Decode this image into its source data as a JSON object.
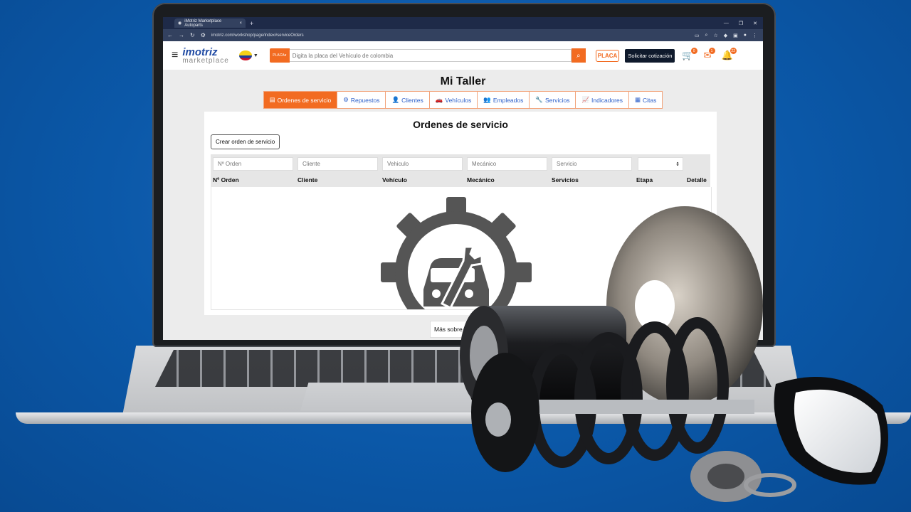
{
  "browser": {
    "tab_title": "iMotriz Marketplace Autoparts",
    "tab_close": "×",
    "new_tab": "+",
    "url": "imotriz.com/workshop/page/index#serviceOrders"
  },
  "header": {
    "logo_main": "imotriz",
    "logo_sub": "marketplace",
    "plate_label": "PLACA",
    "search_placeholder": "Digita la placa del Vehículo de colombia",
    "placa_button": "PLACA",
    "quote_button": "Solicitar cotización",
    "cart_count": "0",
    "messages_count": "1",
    "notifications_count": "22"
  },
  "page": {
    "title": "Mi Taller",
    "tabs": [
      {
        "label": "Ordenes de servicio",
        "icon": "file-icon"
      },
      {
        "label": "Repuestos",
        "icon": "cogs-icon"
      },
      {
        "label": "Clientes",
        "icon": "user-icon"
      },
      {
        "label": "Vehículos",
        "icon": "car-icon"
      },
      {
        "label": "Empleados",
        "icon": "users-icon"
      },
      {
        "label": "Servicios",
        "icon": "wrench-icon"
      },
      {
        "label": "Indicadores",
        "icon": "chart-icon"
      },
      {
        "label": "Citas",
        "icon": "calendar-icon"
      }
    ]
  },
  "orders": {
    "title": "Ordenes de servicio",
    "create_button": "Crear orden de servicio",
    "filters": {
      "order": "Nº Orden",
      "client": "Cliente",
      "vehicle": "Vehiculo",
      "mechanic": "Mecánico",
      "service": "Servicio"
    },
    "columns": [
      "Nº Orden",
      "Cliente",
      "Vehículo",
      "Mecánico",
      "Servicios",
      "Etapa",
      "Detalle"
    ]
  },
  "footer": {
    "more_button": "Más sobre"
  },
  "colors": {
    "accent": "#f26b21",
    "link": "#2a5ec9",
    "background": "#0b58a8"
  }
}
